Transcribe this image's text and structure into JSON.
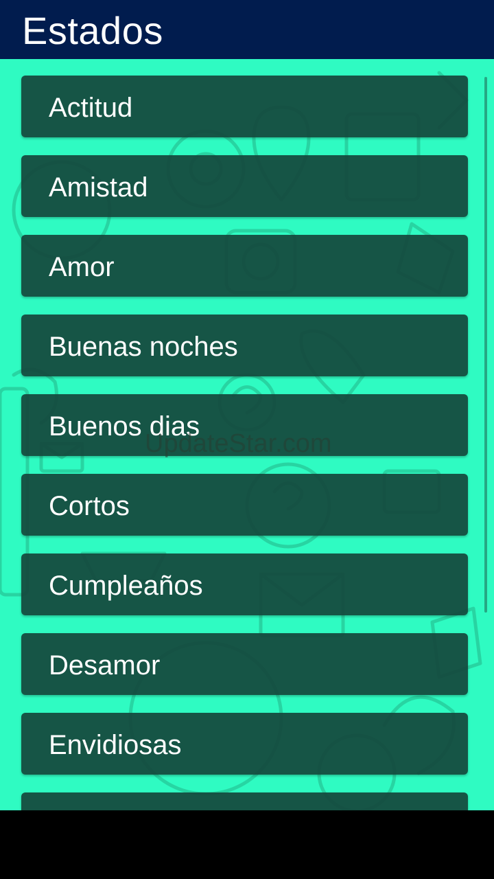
{
  "header": {
    "title": "Estados"
  },
  "list": {
    "items": [
      {
        "label": "Actitud"
      },
      {
        "label": "Amistad"
      },
      {
        "label": "Amor"
      },
      {
        "label": "Buenas noches"
      },
      {
        "label": "Buenos dias"
      },
      {
        "label": "Cortos"
      },
      {
        "label": "Cumpleaños"
      },
      {
        "label": "Desamor"
      },
      {
        "label": "Envidiosas"
      },
      {
        "label": ""
      }
    ]
  },
  "watermark": {
    "text": "UpdateStar.com"
  },
  "colors": {
    "header_bg": "#011c4e",
    "content_bg": "#2ffbc2",
    "item_bg": "#14483c",
    "text": "#ffffff"
  }
}
